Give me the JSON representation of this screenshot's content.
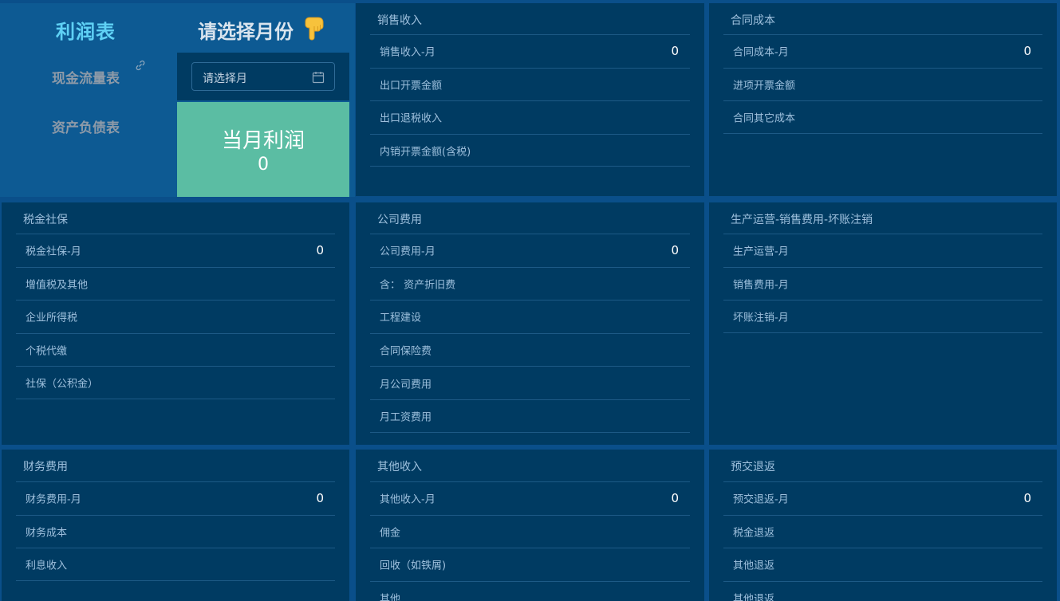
{
  "nav": {
    "profit_tab": "利润表",
    "cash_flow_tab": "现金流量表",
    "balance_tab": "资产负债表",
    "prompt": "请选择月份"
  },
  "date_picker": {
    "placeholder": "请选择月"
  },
  "summary": {
    "label": "当月利润",
    "value": "0"
  },
  "panels": {
    "sales": {
      "title": "销售收入",
      "rows": [
        {
          "label": "销售收入-月",
          "value": "0"
        },
        {
          "label": "出口开票金额",
          "value": ""
        },
        {
          "label": "出口退税收入",
          "value": ""
        },
        {
          "label": "内销开票金额(含税)",
          "value": ""
        }
      ]
    },
    "contract": {
      "title": "合同成本",
      "rows": [
        {
          "label": "合同成本-月",
          "value": "0"
        },
        {
          "label": "进项开票金额",
          "value": ""
        },
        {
          "label": "合同其它成本",
          "value": ""
        }
      ]
    },
    "tax": {
      "title": "税金社保",
      "rows": [
        {
          "label": "税金社保-月",
          "value": "0"
        },
        {
          "label": "增值税及其他",
          "value": ""
        },
        {
          "label": "企业所得税",
          "value": ""
        },
        {
          "label": "个税代缴",
          "value": ""
        },
        {
          "label": "社保（公积金）",
          "value": ""
        }
      ]
    },
    "company": {
      "title": "公司费用",
      "rows": [
        {
          "label": "公司费用-月",
          "value": "0"
        },
        {
          "label": "含： 资产折旧费",
          "value": ""
        },
        {
          "label": "工程建设",
          "value": ""
        },
        {
          "label": "合同保险费",
          "value": ""
        },
        {
          "label": "月公司费用",
          "value": ""
        },
        {
          "label": "月工资费用",
          "value": ""
        }
      ]
    },
    "operation": {
      "title": "生产运营-销售费用-坏账注销",
      "rows": [
        {
          "label": "生产运营-月",
          "value": ""
        },
        {
          "label": "销售费用-月",
          "value": ""
        },
        {
          "label": "坏账注销-月",
          "value": ""
        }
      ]
    },
    "finance": {
      "title": "财务费用",
      "rows": [
        {
          "label": "财务费用-月",
          "value": "0"
        },
        {
          "label": "财务成本",
          "value": ""
        },
        {
          "label": "利息收入",
          "value": ""
        }
      ]
    },
    "other": {
      "title": "其他收入",
      "rows": [
        {
          "label": "其他收入-月",
          "value": "0"
        },
        {
          "label": "佣金",
          "value": ""
        },
        {
          "label": "回收（如铁屑)",
          "value": ""
        },
        {
          "label": "其他",
          "value": ""
        }
      ]
    },
    "refund": {
      "title": "预交退返",
      "rows": [
        {
          "label": "预交退返-月",
          "value": "0"
        },
        {
          "label": "税金退返",
          "value": ""
        },
        {
          "label": "其他退返",
          "value": ""
        },
        {
          "label": "其他退返",
          "value": ""
        }
      ]
    }
  }
}
